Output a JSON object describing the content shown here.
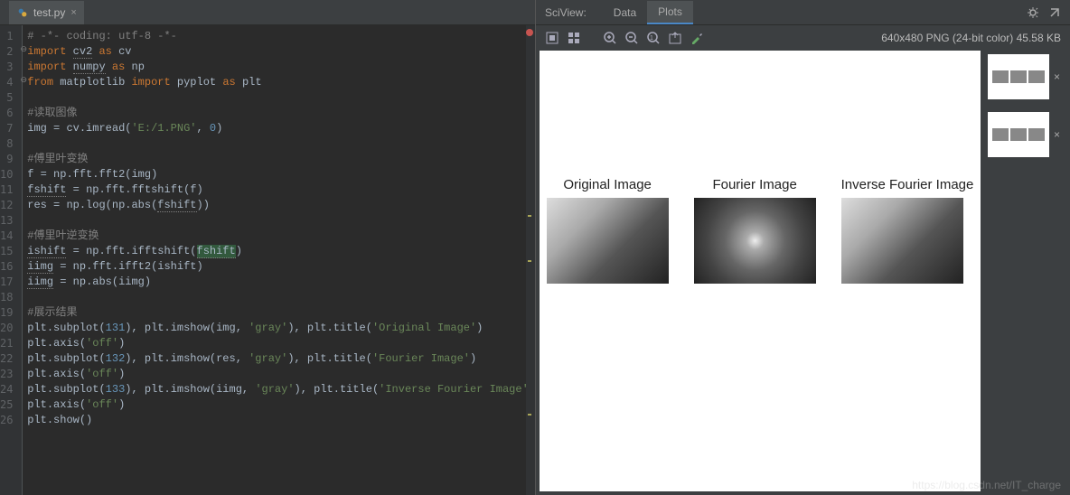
{
  "tab": {
    "filename": "test.py",
    "close": "×"
  },
  "gutter": [
    "1",
    "2",
    "3",
    "4",
    "5",
    "6",
    "7",
    "8",
    "9",
    "10",
    "11",
    "12",
    "13",
    "14",
    "15",
    "16",
    "17",
    "18",
    "19",
    "20",
    "21",
    "22",
    "23",
    "24",
    "25",
    "26"
  ],
  "code": [
    {
      "type": "comment",
      "text": "# -*- coding: utf-8 -*-"
    },
    {
      "type": "import",
      "kw1": "import",
      "mod": "cv2",
      "kw2": "as",
      "alias": "cv"
    },
    {
      "type": "import",
      "kw1": "import",
      "mod": "numpy",
      "kw2": "as",
      "alias": "np"
    },
    {
      "type": "from",
      "kw1": "from",
      "mod": "matplotlib",
      "kw2": "import",
      "item": "pyplot",
      "kw3": "as",
      "alias": "plt"
    },
    {
      "type": "blank"
    },
    {
      "type": "comment",
      "text": "#读取图像"
    },
    {
      "type": "plain",
      "html": "img = cv.imread(<span class='c-green'>'E:/1.PNG'</span>, <span class='c-blue'>0</span>)"
    },
    {
      "type": "blank"
    },
    {
      "type": "comment",
      "text": "#傅里叶变换"
    },
    {
      "type": "plain",
      "html": "f = np.fft.fft2(img)"
    },
    {
      "type": "plain",
      "html": "<span class='c-under'>fshift</span> = np.fft.fftshift(f)"
    },
    {
      "type": "plain",
      "html": "res = np.log(np.abs(<span class='c-under'>fshift</span>))"
    },
    {
      "type": "blank"
    },
    {
      "type": "comment",
      "text": "#傅里叶逆变换"
    },
    {
      "type": "plain",
      "html": "<span class='c-under'>ishift</span> = np.fft.ifftshift(<span class='c-under' style='background:#32593d'>fshift</span>)"
    },
    {
      "type": "plain",
      "html": "<span class='c-under'>iimg</span> = np.fft.ifft2(ishift)"
    },
    {
      "type": "plain",
      "html": "<span class='c-under'>iimg</span> = np.abs(iimg)"
    },
    {
      "type": "blank"
    },
    {
      "type": "comment",
      "text": "#展示结果"
    },
    {
      "type": "plain",
      "html": "plt.subplot(<span class='c-blue'>131</span>), plt.imshow(img, <span class='c-green'>'gray'</span>), plt.title(<span class='c-green'>'Original Image'</span>)"
    },
    {
      "type": "plain",
      "html": "plt.axis(<span class='c-green'>'off'</span>)"
    },
    {
      "type": "plain",
      "html": "plt.subplot(<span class='c-blue'>132</span>), plt.imshow(res, <span class='c-green'>'gray'</span>), plt.title(<span class='c-green'>'Fourier Image'</span>)"
    },
    {
      "type": "plain",
      "html": "plt.axis(<span class='c-green'>'off'</span>)"
    },
    {
      "type": "plain",
      "html": "plt.subplot(<span class='c-blue'>133</span>), plt.imshow(iimg, <span class='c-green'>'gray'</span>), plt.title(<span class='c-green'>'Inverse Fourier Image'</span>)"
    },
    {
      "type": "plain",
      "html": "plt.axis(<span class='c-green'>'off'</span>)"
    },
    {
      "type": "plain",
      "html": "plt.show()"
    }
  ],
  "sciview": {
    "label": "SciView:",
    "tabs": {
      "data": "Data",
      "plots": "Plots"
    },
    "info": "640x480 PNG (24-bit color) 45.58 KB"
  },
  "plots": {
    "titles": [
      "Original Image",
      "Fourier Image",
      "Inverse Fourier Image"
    ]
  },
  "watermark": "https://blog.csdn.net/IT_charge"
}
